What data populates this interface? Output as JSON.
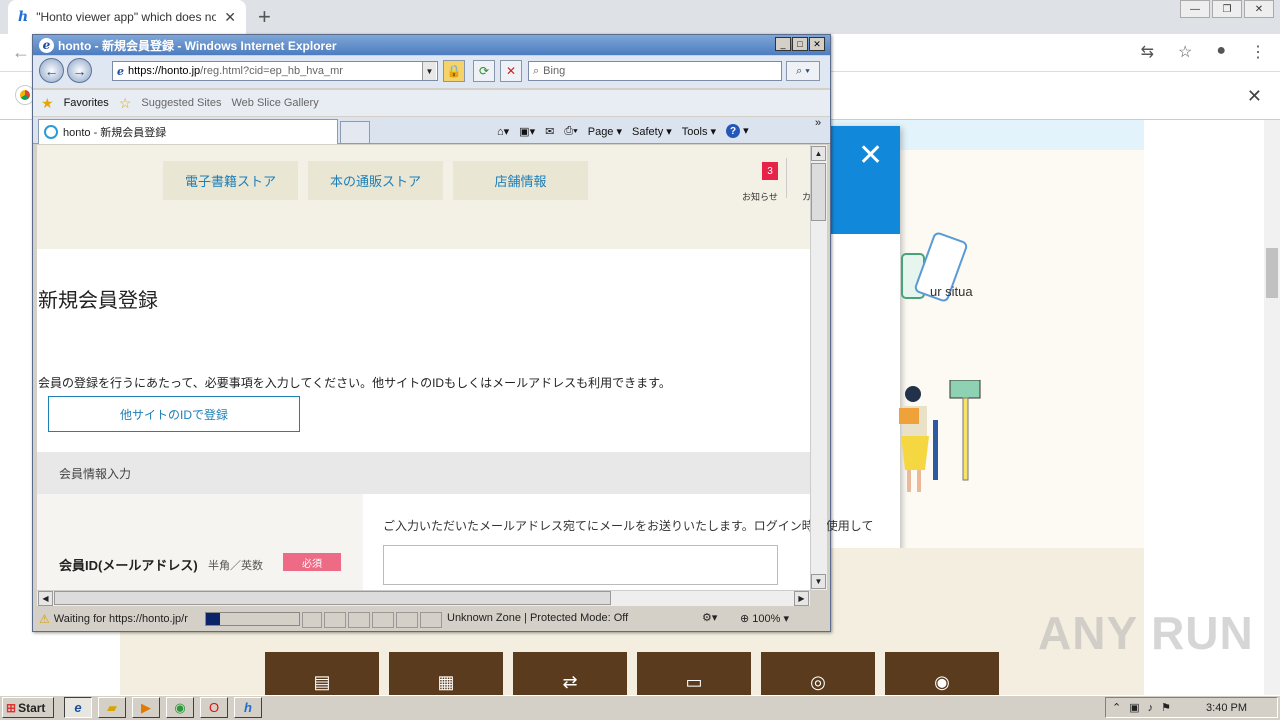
{
  "chrome": {
    "tab_title": "\"Honto viewer app\" which does not r",
    "tab_favicon": "h"
  },
  "background_page": {
    "situa_text": "ur situa",
    "service_icons": [
      "book-stack-icon",
      "books-icon",
      "transfer-icon",
      "sd-card-icon",
      "yen-coin-icon",
      "footprints-icon"
    ]
  },
  "watermark": "ANY RUN",
  "ie": {
    "title": "honto - 新規会員登録 - Windows Internet Explorer",
    "url_host": "https://honto.jp",
    "url_path": "/reg.html?cid=ep_hb_hva_mr",
    "search_placeholder": "Bing",
    "favorites_label": "Favorites",
    "suggested_sites": "Suggested Sites",
    "web_slice": "Web Slice Gallery",
    "tab_title": "honto - 新規会員登録",
    "cmd": {
      "page": "Page",
      "safety": "Safety",
      "tools": "Tools"
    },
    "status_text": "Waiting for https://honto.jp/r",
    "zone": "Unknown Zone | Protected Mode: Off",
    "zoom": "100%"
  },
  "site": {
    "nav": [
      "電子書籍ストア",
      "本の通販ストア",
      "店舗情報"
    ],
    "notice_count": "3",
    "notice_label": "お知らせ",
    "notice_cut": "カ",
    "heading": "新規会員登録",
    "lead": "会員の登録を行うにあたって、必要事項を入力してください。他サイトのIDもしくはメールアドレスも利用できます。",
    "sso_button": "他サイトのIDで登録",
    "section_title": "会員情報入力",
    "field_label": "会員ID(メールアドレス)",
    "field_hint": "半角／英数",
    "required": "必須",
    "field_help": "ご入力いただいたメールアドレス宛てにメールをお送りいたします。ログイン時に使用して"
  },
  "taskbar": {
    "start": "Start",
    "clock": "3:40 PM"
  }
}
